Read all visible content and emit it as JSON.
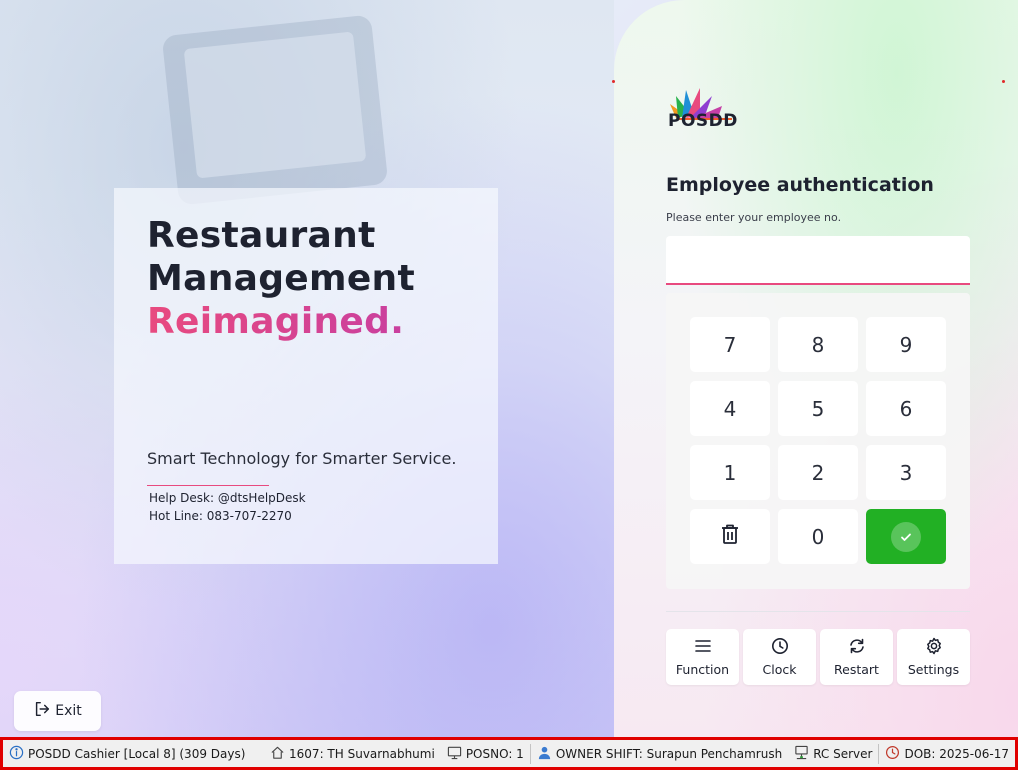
{
  "hero": {
    "line1": "Restaurant",
    "line2": "Management",
    "line3": "Reimagined.",
    "tagline": "Smart Technology for Smarter Service.",
    "help_desk": "Help Desk: @dtsHelpDesk",
    "hot_line": "Hot Line: 083-707-2270"
  },
  "exit_label": "Exit",
  "brand": {
    "name": "POSDD"
  },
  "auth": {
    "title": "Employee authentication",
    "subtitle": "Please enter your employee no.",
    "input_value": ""
  },
  "keypad": {
    "keys": [
      "7",
      "8",
      "9",
      "4",
      "5",
      "6",
      "1",
      "2",
      "3",
      "0"
    ]
  },
  "tools": {
    "function": "Function",
    "clock": "Clock",
    "restart": "Restart",
    "settings": "Settings"
  },
  "statusbar": {
    "app": "POSDD Cashier [Local 8] (309 Days)",
    "branch": "1607: TH Suvarnabhumi",
    "posno": "POSNO: 1",
    "owner_shift": "OWNER SHIFT: Surapun Penchamrush",
    "server": "RC Server",
    "dob": "DOB: 2025-06-17"
  },
  "colors": {
    "accent_pink": "#e84a7f",
    "ok_green": "#22b024",
    "statusbar_border": "#e00000"
  }
}
